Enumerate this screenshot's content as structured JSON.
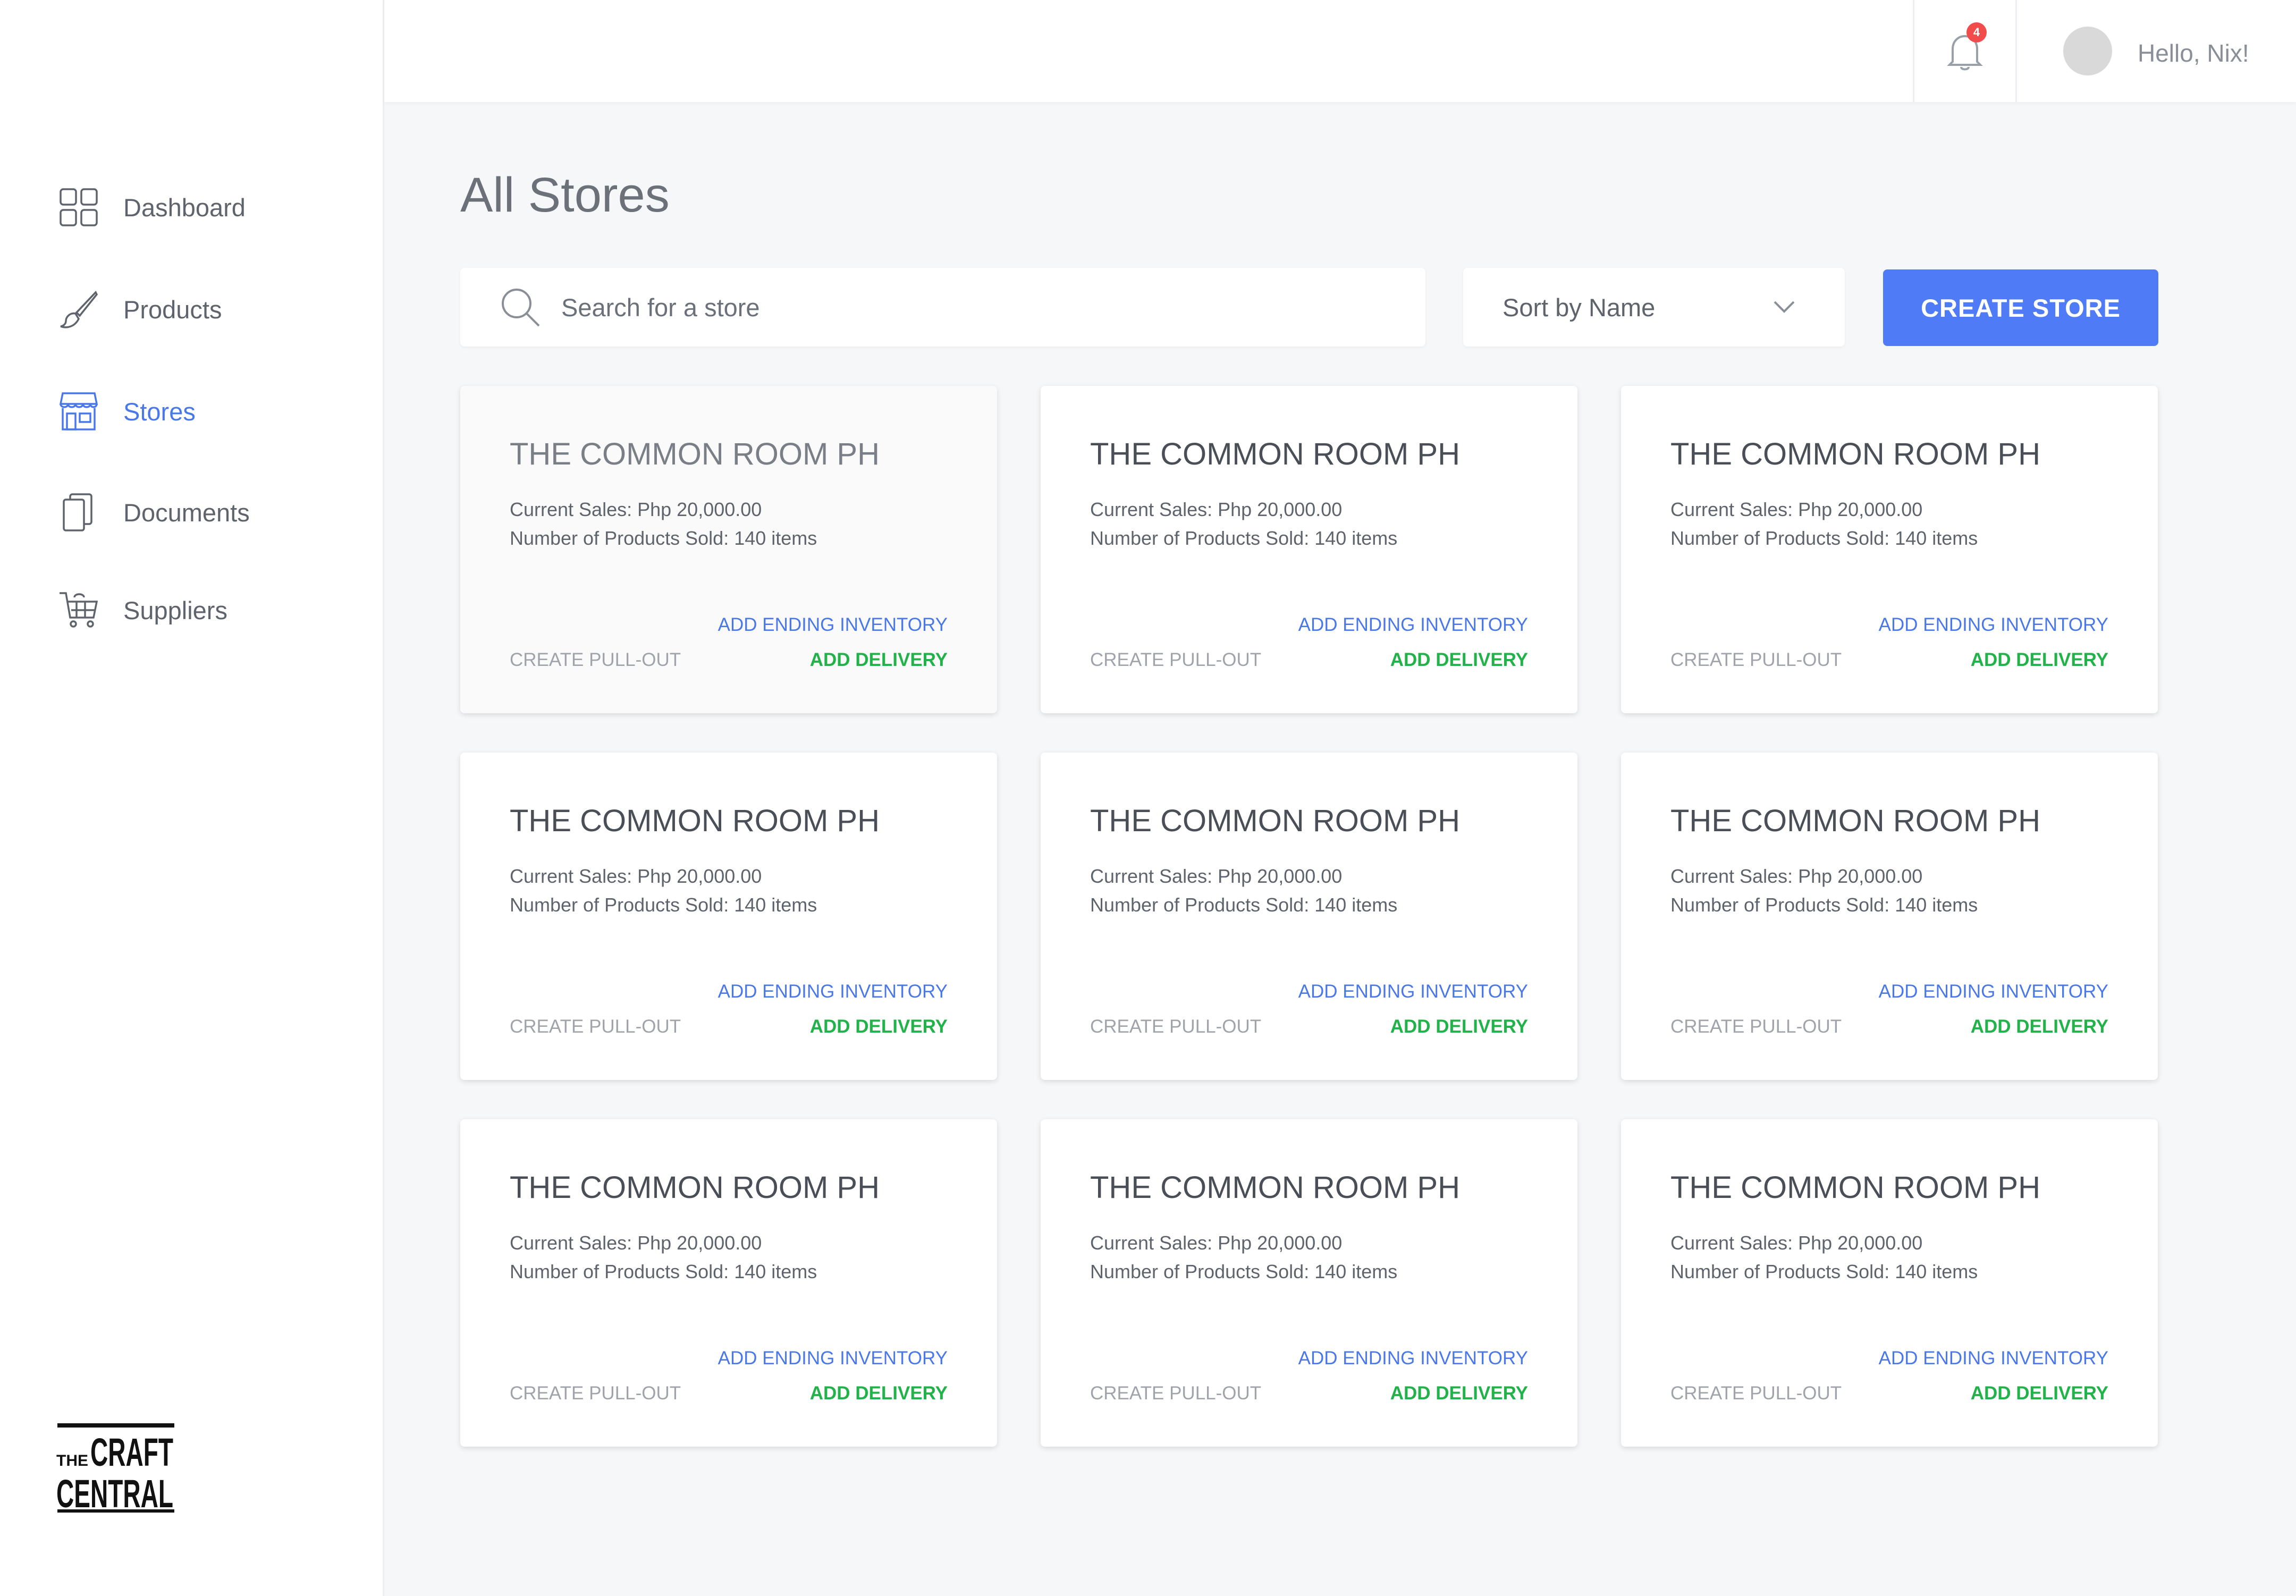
{
  "sidebar": {
    "items": [
      {
        "label": "Dashboard",
        "icon": "grid-icon",
        "active": false
      },
      {
        "label": "Products",
        "icon": "brush-icon",
        "active": false
      },
      {
        "label": "Stores",
        "icon": "store-icon",
        "active": true
      },
      {
        "label": "Documents",
        "icon": "documents-icon",
        "active": false
      },
      {
        "label": "Suppliers",
        "icon": "cart-icon",
        "active": false
      }
    ],
    "logo": {
      "line1": "THE CRAFT",
      "line2": "CENTRAL"
    }
  },
  "header": {
    "notification_count": "4",
    "greeting": "Hello, Nix!"
  },
  "main": {
    "title": "All Stores",
    "search_placeholder": "Search for a store",
    "sort_label": "Sort by Name",
    "create_button": "CREATE STORE",
    "stores": [
      {
        "name": "THE COMMON ROOM PH",
        "sales": "Current Sales: Php 20,000.00",
        "sold": "Number of Products Sold: 140 items"
      },
      {
        "name": "THE COMMON ROOM PH",
        "sales": "Current Sales: Php 20,000.00",
        "sold": "Number of Products Sold: 140 items"
      },
      {
        "name": "THE COMMON ROOM PH",
        "sales": "Current Sales: Php 20,000.00",
        "sold": "Number of Products Sold: 140 items"
      },
      {
        "name": "THE COMMON ROOM PH",
        "sales": "Current Sales: Php 20,000.00",
        "sold": "Number of Products Sold: 140 items"
      },
      {
        "name": "THE COMMON ROOM PH",
        "sales": "Current Sales: Php 20,000.00",
        "sold": "Number of Products Sold: 140 items"
      },
      {
        "name": "THE COMMON ROOM PH",
        "sales": "Current Sales: Php 20,000.00",
        "sold": "Number of Products Sold: 140 items"
      },
      {
        "name": "THE COMMON ROOM PH",
        "sales": "Current Sales: Php 20,000.00",
        "sold": "Number of Products Sold: 140 items"
      },
      {
        "name": "THE COMMON ROOM PH",
        "sales": "Current Sales: Php 20,000.00",
        "sold": "Number of Products Sold: 140 items"
      },
      {
        "name": "THE COMMON ROOM PH",
        "sales": "Current Sales: Php 20,000.00",
        "sold": "Number of Products Sold: 140 items"
      }
    ],
    "card_actions": {
      "add_ending_inventory": "ADD ENDING INVENTORY",
      "create_pull_out": "CREATE PULL-OUT",
      "add_delivery": "ADD DELIVERY"
    }
  },
  "colors": {
    "accent": "#4f7cf6",
    "active_nav": "#4a78e8",
    "delivery": "#22b24a",
    "badge": "#f24b4b"
  }
}
